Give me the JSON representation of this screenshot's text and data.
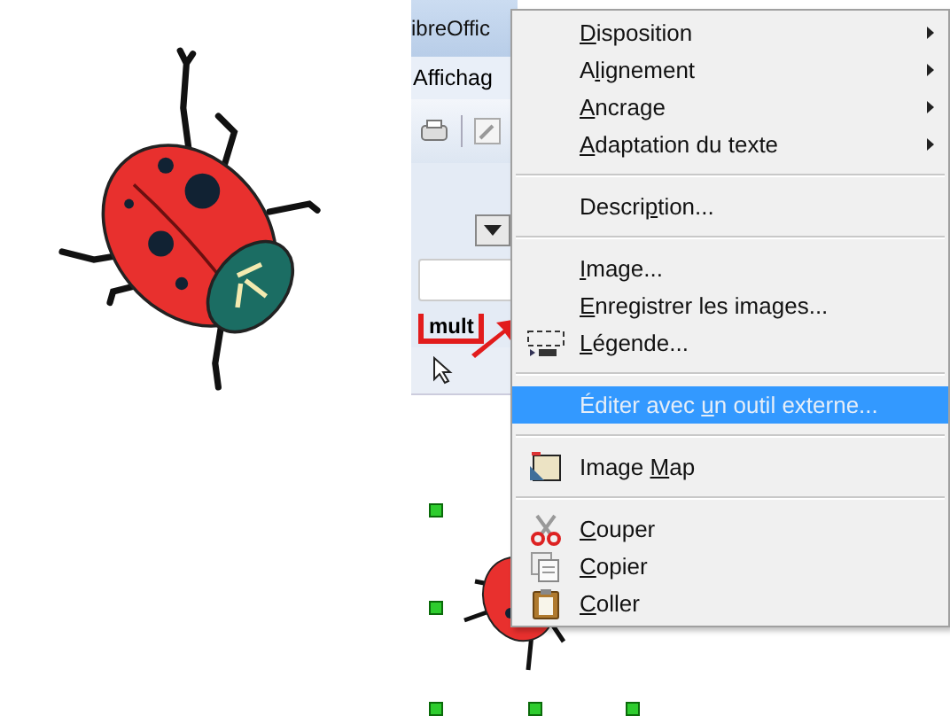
{
  "app": {
    "title": "ibreOffic",
    "menu": "Affichag",
    "callout_text": "mult"
  },
  "context_menu": {
    "items": [
      {
        "kind": "submenu",
        "selected": false,
        "disabled": false,
        "label": [
          {
            "text": "D",
            "underlined": true
          },
          {
            "text": "isposition",
            "underlined": false
          }
        ]
      },
      {
        "kind": "submenu",
        "selected": false,
        "disabled": false,
        "label": [
          {
            "text": "A",
            "underlined": false
          },
          {
            "text": "l",
            "underlined": true
          },
          {
            "text": "ignement",
            "underlined": false
          }
        ]
      },
      {
        "kind": "submenu",
        "selected": false,
        "disabled": false,
        "label": [
          {
            "text": "A",
            "underlined": true
          },
          {
            "text": "ncrage",
            "underlined": false
          }
        ]
      },
      {
        "kind": "submenu",
        "selected": false,
        "disabled": false,
        "label": [
          {
            "text": "A",
            "underlined": true
          },
          {
            "text": "daptation du texte",
            "underlined": false
          }
        ]
      },
      {
        "kind": "separator"
      },
      {
        "kind": "item",
        "selected": false,
        "disabled": false,
        "label": [
          {
            "text": "Descri",
            "underlined": false
          },
          {
            "text": "p",
            "underlined": true
          },
          {
            "text": "tion...",
            "underlined": false
          }
        ]
      },
      {
        "kind": "separator"
      },
      {
        "kind": "item",
        "selected": false,
        "disabled": false,
        "label": [
          {
            "text": "I",
            "underlined": true
          },
          {
            "text": "mage...",
            "underlined": false
          }
        ]
      },
      {
        "kind": "item",
        "selected": false,
        "disabled": false,
        "label": [
          {
            "text": "E",
            "underlined": true
          },
          {
            "text": "nregistrer les images...",
            "underlined": false
          }
        ]
      },
      {
        "kind": "caption",
        "selected": false,
        "disabled": false,
        "label": [
          {
            "text": "L",
            "underlined": true
          },
          {
            "text": "égende...",
            "underlined": false
          }
        ]
      },
      {
        "kind": "separator"
      },
      {
        "kind": "item",
        "selected": true,
        "disabled": true,
        "label": [
          {
            "text": "Éditer avec ",
            "underlined": false
          },
          {
            "text": "u",
            "underlined": true
          },
          {
            "text": "n outil externe...",
            "underlined": false
          }
        ]
      },
      {
        "kind": "separator"
      },
      {
        "kind": "imagemap",
        "selected": false,
        "disabled": false,
        "label": [
          {
            "text": "Image ",
            "underlined": false
          },
          {
            "text": "M",
            "underlined": true
          },
          {
            "text": "ap",
            "underlined": false
          }
        ]
      },
      {
        "kind": "separator"
      },
      {
        "kind": "cut",
        "selected": false,
        "disabled": false,
        "label": [
          {
            "text": "C",
            "underlined": true
          },
          {
            "text": "ouper",
            "underlined": false
          }
        ]
      },
      {
        "kind": "copy",
        "selected": false,
        "disabled": false,
        "label": [
          {
            "text": "C",
            "underlined": true
          },
          {
            "text": "opier",
            "underlined": false
          }
        ]
      },
      {
        "kind": "paste",
        "selected": false,
        "disabled": false,
        "label": [
          {
            "text": "C",
            "underlined": true
          },
          {
            "text": "oller",
            "underlined": false
          }
        ]
      }
    ]
  }
}
